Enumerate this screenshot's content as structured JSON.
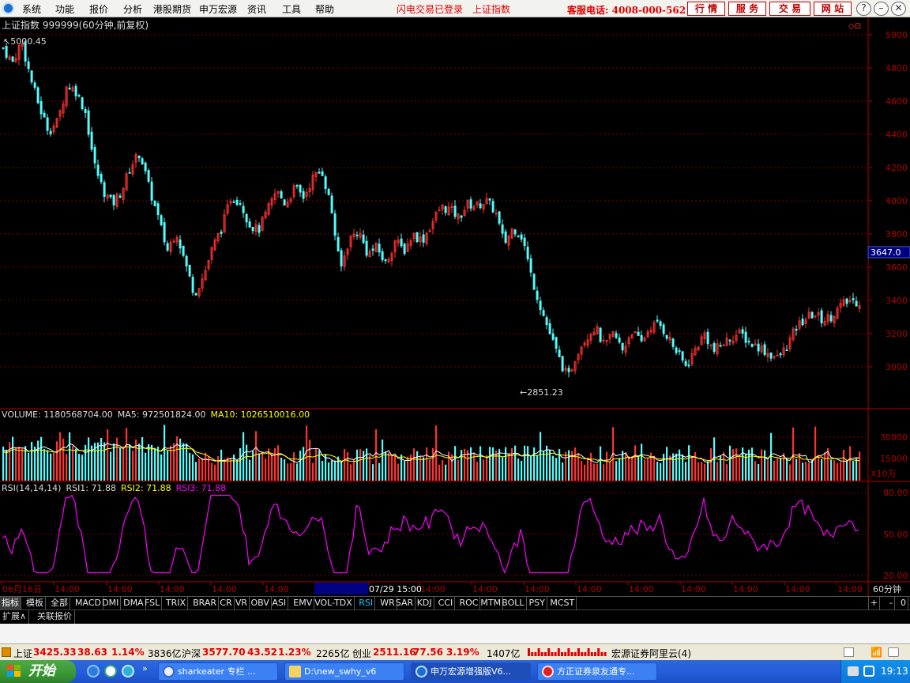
{
  "menu": {
    "items": [
      "系统",
      "功能",
      "报价",
      "分析",
      "港股期货",
      "申万宏源",
      "资讯",
      "工具",
      "帮助"
    ],
    "alert_login": "闪电交易已登录",
    "alert_index": "上证指数",
    "hotline": "客服电话: 4008-000-562",
    "right_buttons": [
      "行 情",
      "服 务",
      "交 易",
      "网 站"
    ],
    "window_buttons": [
      "?",
      "–",
      "⧉",
      "✕"
    ]
  },
  "chart": {
    "title": "上证指数 999999(60分钟,前复权)",
    "marker_glyph": "◇⊡",
    "high_label": "5000.45",
    "low_label": "2851.23",
    "current_price": "3647.0",
    "price_axis": [
      "5000",
      "4800",
      "4600",
      "4400",
      "4200",
      "4000",
      "3800",
      "3600",
      "3400",
      "3200",
      "3000"
    ],
    "volume_header": {
      "label": "VOLUME: 1180568704.00",
      "ma5": "MA5: 972501824.00",
      "ma10": "MA10: 1026510016.00"
    },
    "volume_axis": [
      "30000",
      "15000"
    ],
    "volume_unit": "X10万",
    "rsi_header": {
      "label": "RSI(14,14,14)",
      "rsi1": "RSI1: 71.88",
      "rsi2": "RSI2: 71.88",
      "rsi3": "RSI3: 71.88"
    },
    "rsi_axis": [
      "80.00",
      "50.00",
      "20.00"
    ],
    "time_axis": [
      "06月16日",
      "14:00",
      "14:00",
      "14:00",
      "14:00",
      "14:00",
      "14:00",
      "07/29 15:00",
      "14:00",
      "14:00",
      "14:00",
      "14:00",
      "14:00",
      "14:00",
      "14:00",
      "14:00",
      "14:00"
    ],
    "period_label": "60分钟",
    "colors": {
      "up": "#ff3232",
      "down": "#54fcfc",
      "ma5": "#ffffff",
      "ma10": "#ffff00",
      "rsi": "#ff00ff",
      "grid": "#7a0000",
      "axis": "#b00000"
    }
  },
  "chart_data": {
    "type": "candlestick",
    "title": "上证指数 999999(60分钟,前复权)",
    "close_path": [
      4920,
      4830,
      4960,
      4740,
      4560,
      4420,
      4480,
      4700,
      4660,
      4540,
      4220,
      4060,
      3980,
      4060,
      4210,
      4290,
      4080,
      3900,
      3700,
      3820,
      3620,
      3440,
      3550,
      3720,
      3840,
      4020,
      4000,
      3860,
      3820,
      3940,
      4060,
      3980,
      4080,
      4020,
      4140,
      4180,
      3960,
      3580,
      3770,
      3820,
      3680,
      3720,
      3620,
      3760,
      3700,
      3800,
      3760,
      3860,
      3960,
      3950,
      3900,
      3980,
      3970,
      4000,
      3940,
      3740,
      3840,
      3780,
      3540,
      3360,
      3200,
      3050,
      2930,
      3090,
      3180,
      3240,
      3120,
      3200,
      3100,
      3220,
      3140,
      3240,
      3260,
      3180,
      3080,
      3000,
      3110,
      3200,
      3090,
      3140,
      3180,
      3200,
      3140,
      3120,
      3080,
      3050,
      3120,
      3230,
      3290,
      3320,
      3280,
      3310,
      3370,
      3400,
      3390
    ],
    "volume_ma": [
      22000,
      15000
    ],
    "rsi_range": [
      20,
      80
    ],
    "high": 5000.45,
    "low": 2851.23,
    "last": 3647.0
  },
  "indicator_tabs": [
    "指标",
    "模板",
    "全部",
    "MACD",
    "DMI",
    "DMA",
    "FSL",
    "TRIX",
    "BRAR",
    "CR",
    "VR",
    "OBV",
    "ASI",
    "EMV",
    "VOL-TDX",
    "RSI",
    "WR",
    "SAR",
    "KDJ",
    "CCI",
    "ROC",
    "MTM",
    "BOLL",
    "PSY",
    "MCST"
  ],
  "tab_right": [
    "+",
    "-",
    "0"
  ],
  "ext_tabs": [
    "扩展∧",
    "关联报价"
  ],
  "status": {
    "sh_name": "上证",
    "sh_price": "3425.33",
    "sh_chg": "38.63",
    "sh_pct": "1.14%",
    "sh_amt": "3836亿",
    "hs_name": "沪深",
    "hs_price": "3577.70",
    "hs_chg": "43.52",
    "hs_pct": "1.23%",
    "hs_amt": "2265亿",
    "cy_name": "创业",
    "cy_price": "2511.16",
    "cy_chg": "77.56",
    "cy_pct": "3.19%",
    "cy_amt": "1407亿",
    "server": "宏源证券阿里云(4)"
  },
  "taskbar": {
    "start": "开始",
    "tasks": [
      "sharkeater 专栏 ...",
      "D:\\new_swhy_v6",
      "申万宏源增强版V6...",
      "方正证券泉友通专..."
    ],
    "clock": "19:13"
  }
}
